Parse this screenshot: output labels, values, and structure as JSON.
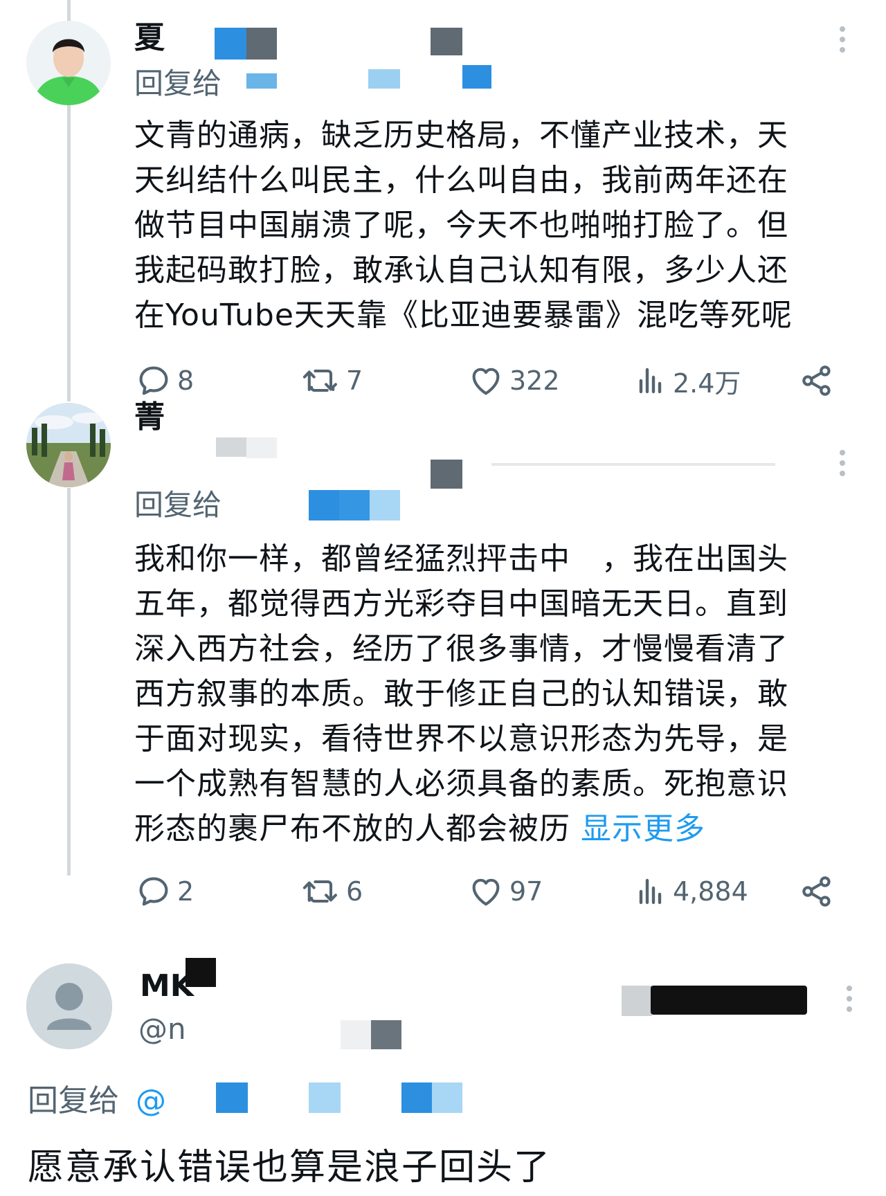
{
  "tweets": [
    {
      "name": "夏",
      "reply_prefix": "回复给",
      "body": "文青的通病，缺乏历史格局，不懂产业技术，天天纠结什么叫民主，什么叫自由，我前两年还在做节目中国崩溃了呢，今天不也啪啪打脸了。但我起码敢打脸，敢承认自己认知有限，多少人还在YouTube天天靠《比亚迪要暴雷》混吃等死呢",
      "body_lines": [
        "文青的通病，缺乏历史格局，不懂产业技术，天",
        "天纠结什么叫民主，什么叫自由，我前两年还在",
        "做节目中国崩溃了呢，今天不也啪啪打脸了。但",
        "我起码敢打脸，敢承认自己认知有限，多少人还",
        "在YouTube天天靠《比亚迪要暴雷》混吃等死呢"
      ],
      "replies": "8",
      "retweets": "7",
      "likes": "322",
      "views": "2.4万"
    },
    {
      "name": "菁",
      "reply_prefix": "回复给",
      "body_lines": [
        "我和你一样，都曾经猛烈抨击中　，我在出国头",
        "五年，都觉得西方光彩夺目中国暗无天日。直到",
        "深入西方社会，经历了很多事情，才慢慢看清了",
        "西方叙事的本质。敢于修正自己的认知错误，敢",
        "于面对现实，看待世界不以意识形态为先导，是",
        "一个成熟有智慧的人必须具备的素质。死抱意识",
        "形态的裹尸布不放的人都会被历 "
      ],
      "show_more": "显示更多",
      "replies": "2",
      "retweets": "6",
      "likes": "97",
      "views": "4,884"
    },
    {
      "name": "MK",
      "handle": "@n",
      "reply_prefix": "回复给",
      "reply_handle_fragment": "@",
      "body": "愿意承认错误也算是浪子回头了"
    }
  ],
  "icons": {
    "reply": "reply-icon",
    "retweet": "retweet-icon",
    "like": "heart-icon",
    "views": "views-icon",
    "share": "share-icon",
    "more": "more-vertical-icon"
  },
  "colors": {
    "text": "#0f1419",
    "muted": "#536471",
    "link": "#1d9bf0",
    "thread_line": "#d3d8dc"
  }
}
